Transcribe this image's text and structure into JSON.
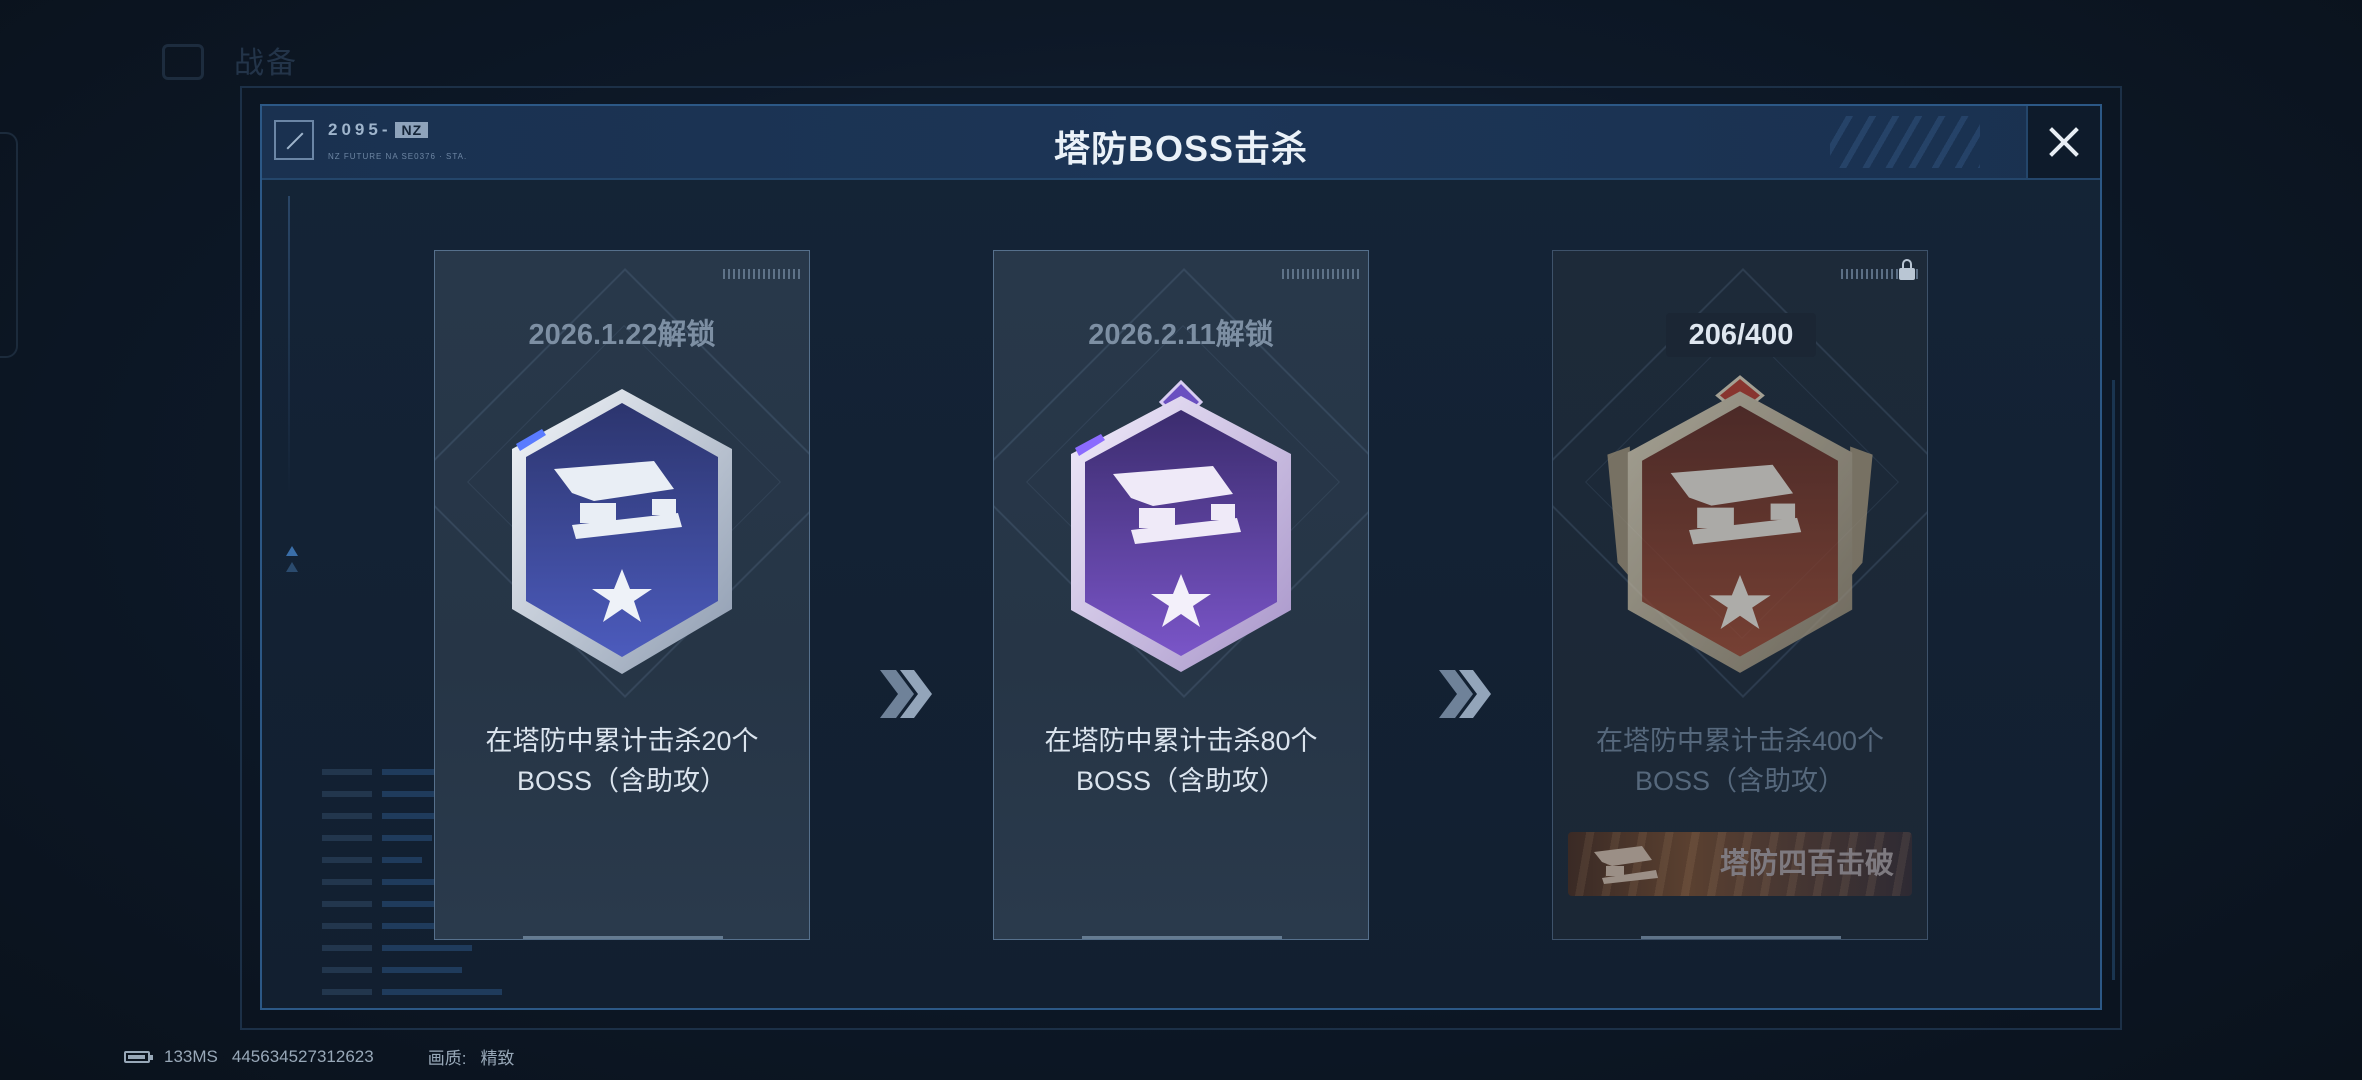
{
  "background": {
    "title": "战备"
  },
  "header": {
    "logo_code": "2095-",
    "logo_tag": "NZ",
    "logo_subtitle": "NZ FUTURE NA SE0376 · STA.",
    "title": "塔防BOSS击杀"
  },
  "cards": [
    {
      "unlock_label": "2026.1.22解锁",
      "description_line1": "在塔防中累计击杀20个",
      "description_line2": "BOSS（含助攻）",
      "tier": "silver",
      "tier_color": "#3d4c9e"
    },
    {
      "unlock_label": "2026.2.11解锁",
      "description_line1": "在塔防中累计击杀80个",
      "description_line2": "BOSS（含助攻）",
      "tier": "purple",
      "tier_color": "#5b3f9a"
    },
    {
      "progress_current": "206",
      "progress_total": "/400",
      "description_line1": "在塔防中累计击杀400个",
      "description_line2": "BOSS（含助攻）",
      "reward_title": "塔防四百击破",
      "tier": "bronze",
      "tier_color": "#7a3628",
      "locked": true
    }
  ],
  "footer": {
    "ping": "133MS",
    "player_id": "445634527312623",
    "quality_label": "画质:",
    "quality_value": "精致"
  },
  "colors": {
    "accent_border": "#2c5886",
    "header_bg": "#1c3556",
    "panel_bg": "#142437"
  },
  "icons": [
    "close-icon",
    "lock-icon",
    "chevron-double-right-icon",
    "battery-icon",
    "turret-icon",
    "star-icon"
  ]
}
